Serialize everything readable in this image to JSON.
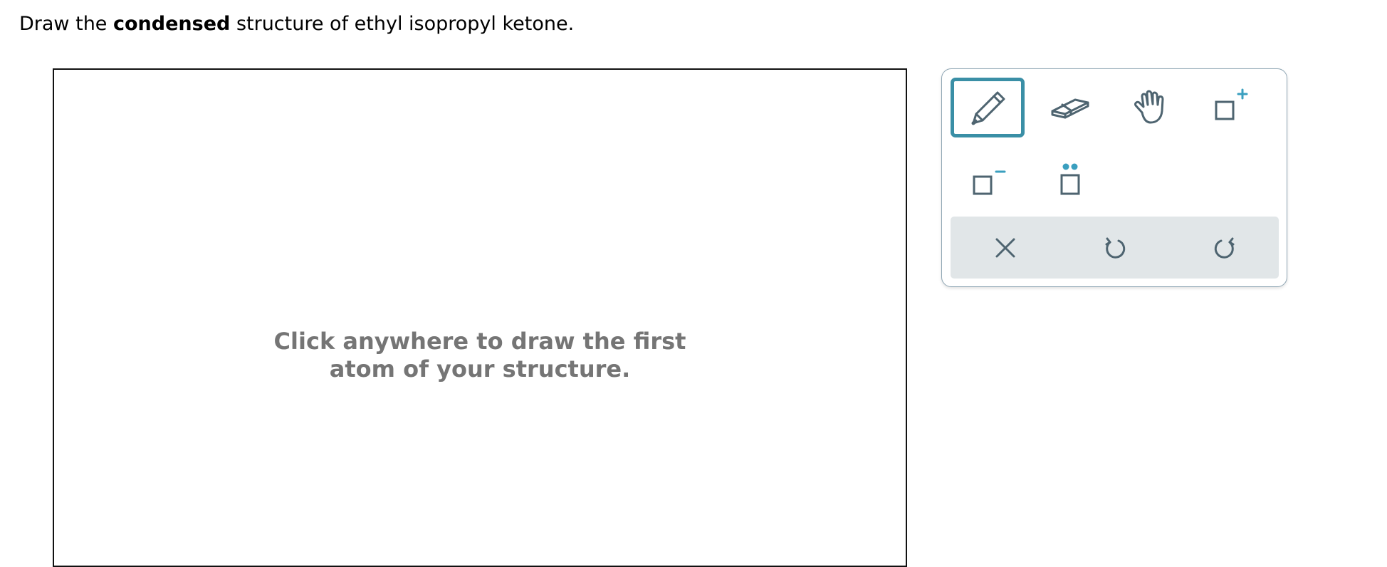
{
  "prompt": {
    "pre": "Draw the ",
    "bold": "condensed",
    "post": " structure of ethyl isopropyl ketone."
  },
  "canvas": {
    "hint_line1": "Click anywhere to draw the first",
    "hint_line2": "atom of your structure."
  },
  "toolbox": {
    "tools": [
      {
        "icon": "pencil-icon",
        "active": true
      },
      {
        "icon": "eraser-icon",
        "active": false
      },
      {
        "icon": "hand-icon",
        "active": false
      },
      {
        "icon": "positive-charge-icon",
        "active": false
      },
      {
        "icon": "negative-charge-icon",
        "active": false
      },
      {
        "icon": "lone-pair-icon",
        "active": false
      }
    ],
    "actions": [
      {
        "icon": "close-icon"
      },
      {
        "icon": "undo-icon"
      },
      {
        "icon": "redo-icon"
      }
    ],
    "colors": {
      "icon": "#4e6470",
      "accent": "#3a9fbf",
      "active_border": "#3a8fa6",
      "action_bar": "#e1e6e8"
    }
  }
}
